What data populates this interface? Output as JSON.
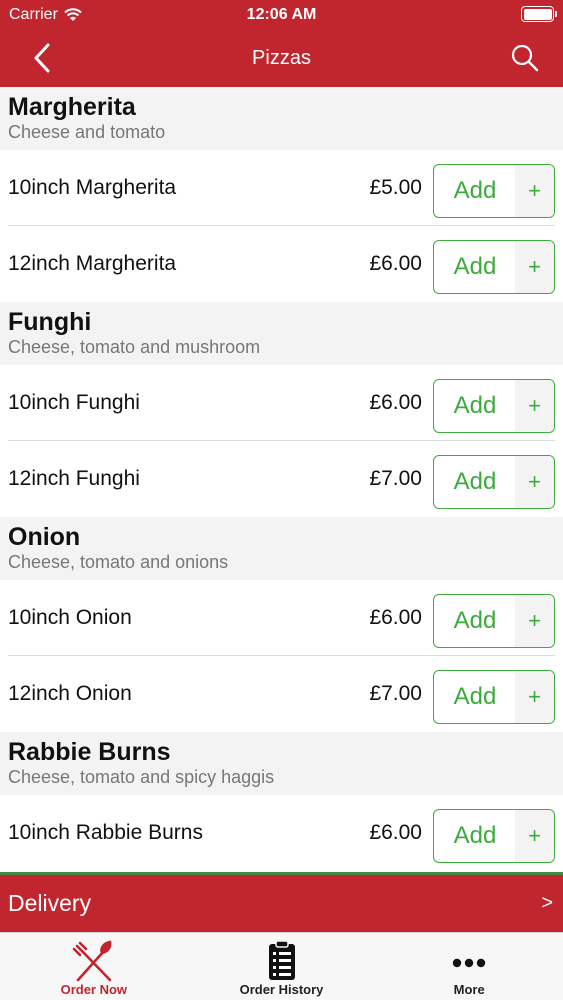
{
  "colors": {
    "brand": "#c1262f",
    "accent": "#3cab3c"
  },
  "status_bar": {
    "carrier": "Carrier",
    "time": "12:06 AM"
  },
  "nav": {
    "title": "Pizzas"
  },
  "sections": [
    {
      "name": "Margherita",
      "desc": "Cheese and tomato",
      "items": [
        {
          "label": "10inch Margherita",
          "price": "£5.00"
        },
        {
          "label": "12inch Margherita",
          "price": "£6.00"
        }
      ]
    },
    {
      "name": "Funghi",
      "desc": "Cheese, tomato and mushroom",
      "items": [
        {
          "label": "10inch Funghi",
          "price": "£6.00"
        },
        {
          "label": "12inch Funghi",
          "price": "£7.00"
        }
      ]
    },
    {
      "name": "Onion",
      "desc": "Cheese, tomato and onions",
      "items": [
        {
          "label": "10inch Onion",
          "price": "£6.00"
        },
        {
          "label": "12inch Onion",
          "price": "£7.00"
        }
      ]
    },
    {
      "name": "Rabbie Burns",
      "desc": "Cheese, tomato and spicy haggis",
      "items": [
        {
          "label": "10inch Rabbie Burns",
          "price": "£6.00"
        }
      ]
    }
  ],
  "add_label": "Add",
  "add_plus": "+",
  "delivery": {
    "label": "Delivery",
    "chevron": ">"
  },
  "tabs": [
    {
      "label": "Order Now",
      "icon": "fork-knife-icon",
      "active": true
    },
    {
      "label": "Order History",
      "icon": "clipboard-list-icon",
      "active": false
    },
    {
      "label": "More",
      "icon": "more-dots-icon",
      "active": false
    }
  ]
}
